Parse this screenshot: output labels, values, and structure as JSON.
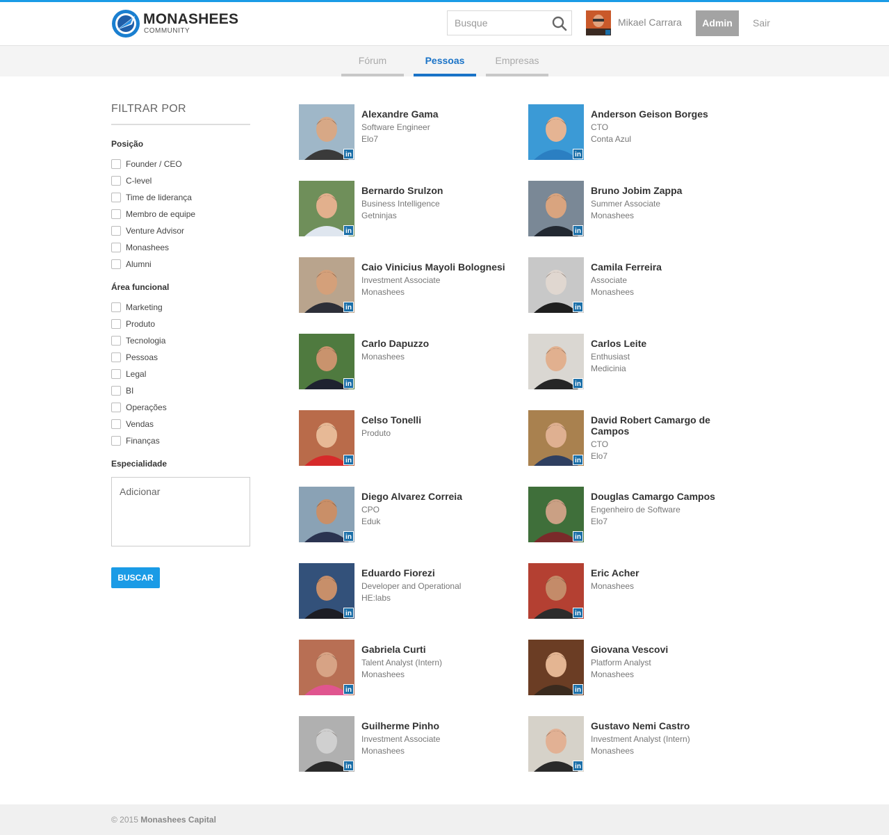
{
  "header": {
    "brand": "MONASHEES",
    "brand_sub": "COMMUNITY",
    "search_placeholder": "Busque",
    "user_name": "Mikael Carrara",
    "admin_label": "Admin",
    "logout_label": "Sair"
  },
  "tabs": [
    {
      "label": "Fórum",
      "active": false
    },
    {
      "label": "Pessoas",
      "active": true
    },
    {
      "label": "Empresas",
      "active": false
    }
  ],
  "filters": {
    "title": "FILTRAR POR",
    "position_title": "Posição",
    "positions": [
      "Founder / CEO",
      "C-level",
      "Time de liderança",
      "Membro de equipe",
      "Venture Advisor",
      "Monashees",
      "Alumni"
    ],
    "area_title": "Área funcional",
    "areas": [
      "Marketing",
      "Produto",
      "Tecnologia",
      "Pessoas",
      "Legal",
      "BI",
      "Operações",
      "Vendas",
      "Finanças"
    ],
    "specialty_title": "Especialidade",
    "specialty_placeholder": "Adicionar",
    "search_button": "BUSCAR"
  },
  "people": [
    {
      "name": "Alexandre Gama",
      "lines": [
        "Software Engineer",
        "Elo7"
      ]
    },
    {
      "name": "Anderson Geison Borges",
      "lines": [
        "CTO",
        "Conta Azul"
      ]
    },
    {
      "name": "Bernardo Srulzon",
      "lines": [
        "Business Intelligence",
        "Getninjas"
      ]
    },
    {
      "name": "Bruno Jobim Zappa",
      "lines": [
        "Summer Associate",
        "Monashees"
      ]
    },
    {
      "name": "Caio Vinicius Mayoli Bolognesi",
      "lines": [
        "Investment Associate",
        "Monashees"
      ]
    },
    {
      "name": "Camila Ferreira",
      "lines": [
        "Associate",
        "Monashees"
      ]
    },
    {
      "name": "Carlo Dapuzzo",
      "lines": [
        "Monashees"
      ]
    },
    {
      "name": "Carlos Leite",
      "lines": [
        "Enthusiast",
        "Medicinia"
      ]
    },
    {
      "name": "Celso Tonelli",
      "lines": [
        "Produto"
      ]
    },
    {
      "name": "David Robert Camargo de Campos",
      "lines": [
        "CTO",
        "Elo7"
      ]
    },
    {
      "name": "Diego Alvarez Correia",
      "lines": [
        "CPO",
        "Eduk"
      ]
    },
    {
      "name": "Douglas Camargo Campos",
      "lines": [
        "Engenheiro de Software",
        "Elo7"
      ]
    },
    {
      "name": "Eduardo Fiorezi",
      "lines": [
        "Developer and Operational",
        "HE:labs"
      ]
    },
    {
      "name": "Eric Acher",
      "lines": [
        "Monashees"
      ]
    },
    {
      "name": "Gabriela Curti",
      "lines": [
        "Talent Analyst (Intern)",
        "Monashees"
      ]
    },
    {
      "name": "Giovana Vescovi",
      "lines": [
        "Platform Analyst",
        "Monashees"
      ]
    },
    {
      "name": "Guilherme Pinho",
      "lines": [
        "Investment Associate",
        "Monashees"
      ]
    },
    {
      "name": "Gustavo Nemi Castro",
      "lines": [
        "Investment Analyst (Intern)",
        "Monashees"
      ]
    }
  ],
  "linkedin_badge": "in",
  "footer": {
    "copyright": "© 2015",
    "company": "Monashees Capital"
  },
  "colors": {
    "accent": "#1a9be6",
    "active_tab": "#1a73c7",
    "admin_button": "#a3a3a3",
    "linkedin": "#1b6fa8"
  }
}
